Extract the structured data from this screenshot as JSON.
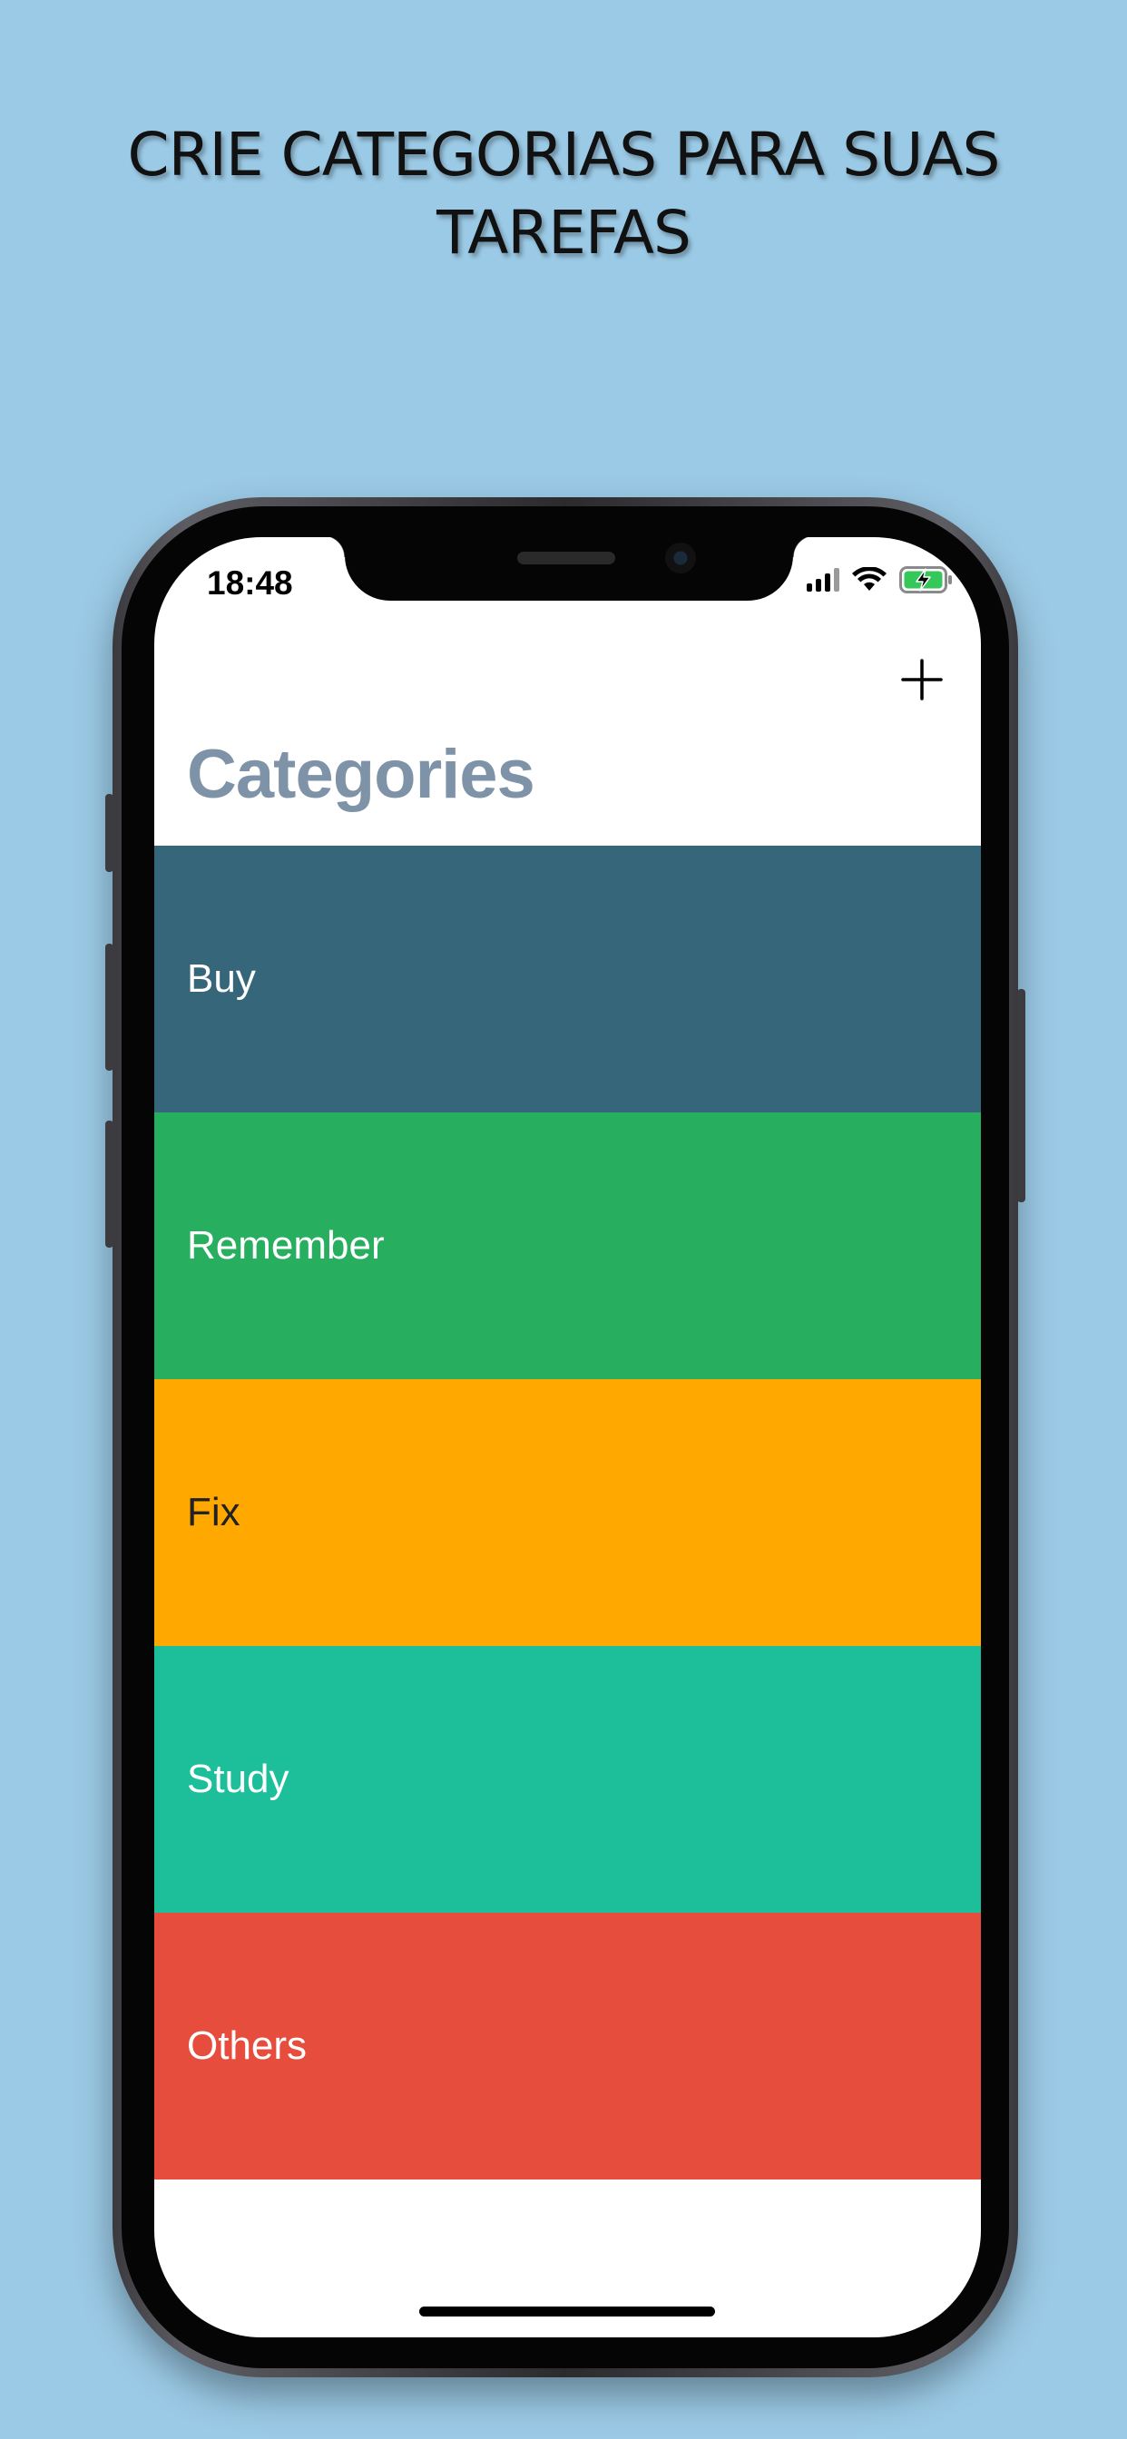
{
  "headline": {
    "line1": "CRIE CATEGORIAS PARA SUAS",
    "line2": "TAREFAS"
  },
  "status_bar": {
    "time": "18:48",
    "icons": [
      "cellular-signal-icon",
      "wifi-icon",
      "battery-charging-icon"
    ]
  },
  "nav": {
    "add_icon": "plus-icon",
    "title": "Categories"
  },
  "categories": [
    {
      "label": "Buy",
      "color": "#36667a",
      "text_color": "#ffffff"
    },
    {
      "label": "Remember",
      "color": "#27ae5f",
      "text_color": "#ffffff"
    },
    {
      "label": "Fix",
      "color": "#ffa900",
      "text_color": "#222222"
    },
    {
      "label": "Study",
      "color": "#1dbf9b",
      "text_color": "#ffffff"
    },
    {
      "label": "Others",
      "color": "#e74d3c",
      "text_color": "#ffffff"
    }
  ],
  "colors": {
    "background": "#9bcae6",
    "title": "#7e93a8"
  }
}
